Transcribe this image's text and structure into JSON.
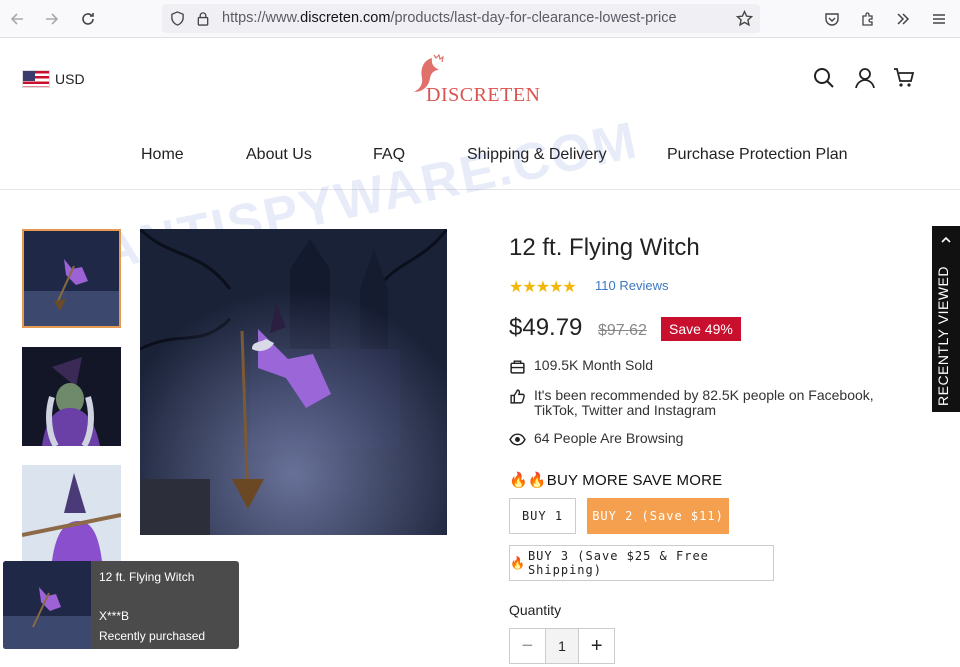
{
  "browser": {
    "url_prefix": "https://www.",
    "url_domain": "discreten.com",
    "url_path": "/products/last-day-for-clearance-lowest-price"
  },
  "header": {
    "currency": "USD",
    "logo_text": "DISCRETEN"
  },
  "menu": {
    "items": [
      "Home",
      "About Us",
      "FAQ",
      "Shipping & Delivery",
      "Purchase Protection Plan"
    ]
  },
  "product": {
    "title": "12 ft. Flying Witch",
    "stars": "★★★★★",
    "reviews": "110 Reviews",
    "price": "$49.79",
    "old_price": "$97.62",
    "save_badge": "Save 49%",
    "features": [
      "109.5K Month Sold",
      "It's been recommended by 82.5K people on Facebook, TikTok, Twitter and Instagram",
      "64 People Are Browsing"
    ],
    "promo_heading": "BUY MORE SAVE MORE",
    "buy_options": [
      "BUY 1",
      "BUY 2 (Save $11)",
      "BUY 3 (Save $25 & Free Shipping)"
    ],
    "quantity_label": "Quantity",
    "quantity_value": "1",
    "rating": 5
  },
  "recently_viewed": "RECENTLY VIEWED",
  "toast": {
    "title": "12 ft. Flying Witch",
    "buyer": "X***B",
    "status": "Recently purchased"
  },
  "watermark": "MYANTISPYWARE.COM",
  "colors": {
    "accent": "#f5a04e",
    "sale_badge": "#c8102e",
    "link": "#3c78c3",
    "star": "#f2b705",
    "logo": "#d9544f"
  }
}
